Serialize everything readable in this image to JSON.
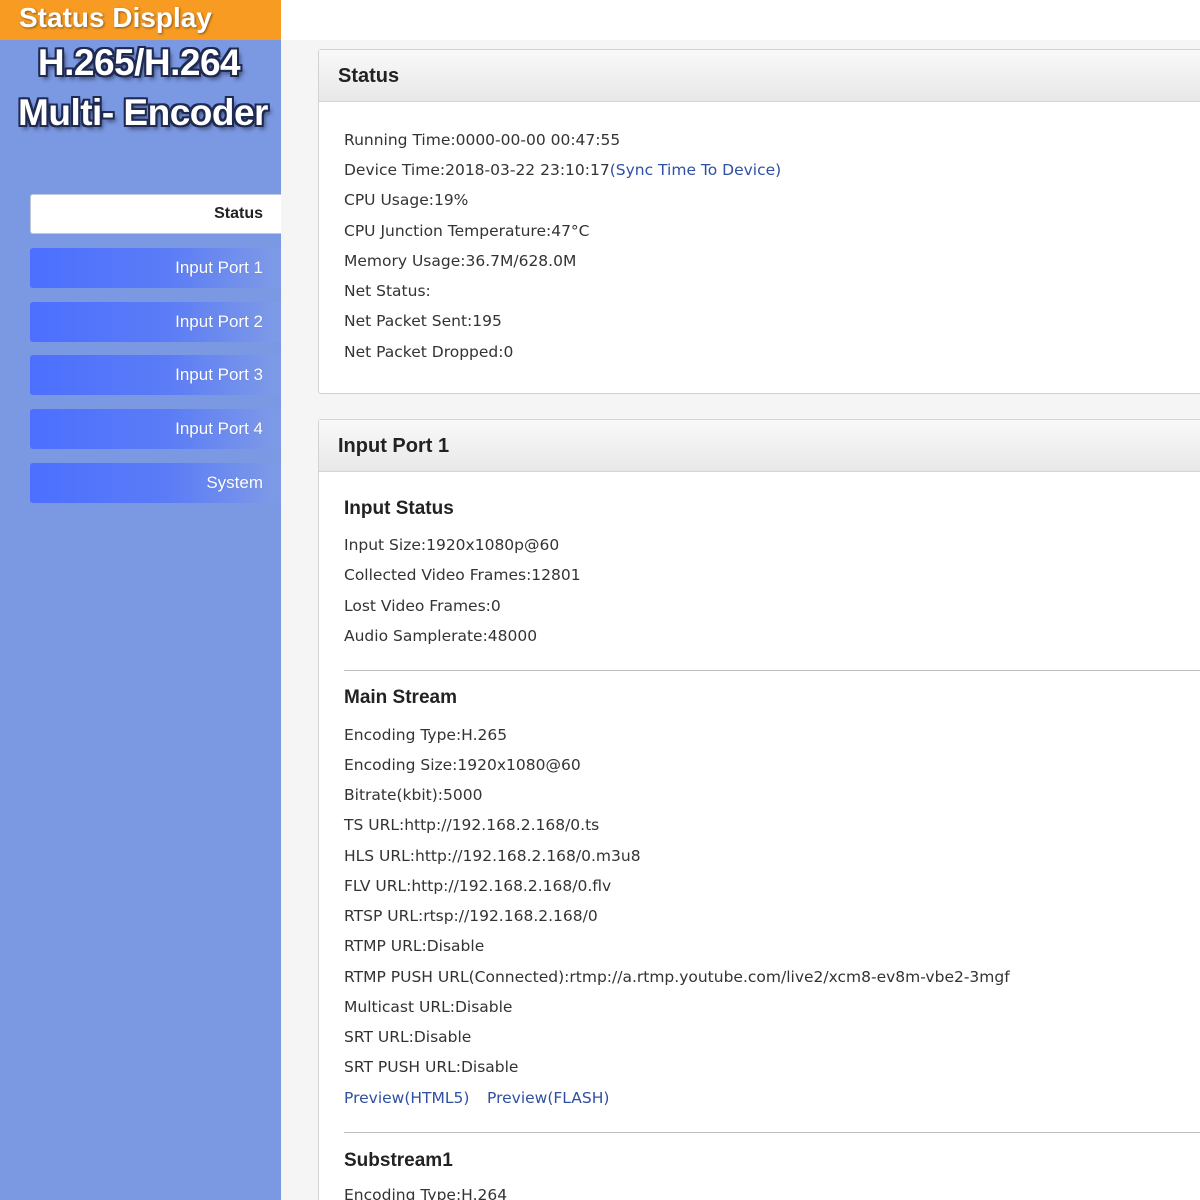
{
  "banner": {
    "title": "Status Display"
  },
  "logo": {
    "line1": "H.265/H.264",
    "line2": "Multi- Encoder"
  },
  "sidebar": {
    "items": [
      {
        "label": "Status",
        "active": true
      },
      {
        "label": "Input Port 1"
      },
      {
        "label": "Input Port 2"
      },
      {
        "label": "Input Port 3"
      },
      {
        "label": "Input Port 4"
      },
      {
        "label": "System"
      }
    ]
  },
  "status_panel": {
    "title": "Status",
    "running_time": "Running Time:0000-00-00 00:47:55",
    "device_time": "Device Time:2018-03-22 23:10:17",
    "sync_link": "(Sync Time To Device)",
    "cpu_usage": "CPU Usage:19%",
    "cpu_temp": "CPU Junction Temperature:47°C",
    "memory": "Memory Usage:36.7M/628.0M",
    "net_status": "Net Status:",
    "packets_sent": "Net Packet Sent:195",
    "packets_dropped": "Net Packet Dropped:0"
  },
  "port1_panel": {
    "title": "Input Port 1",
    "input_status": {
      "heading": "Input Status",
      "input_size": "Input Size:1920x1080p@60",
      "collected_frames": "Collected Video Frames:12801",
      "lost_frames": "Lost Video Frames:0",
      "audio_samplerate": "Audio Samplerate:48000"
    },
    "main_stream": {
      "heading": "Main Stream",
      "encoding_type": "Encoding Type:H.265",
      "encoding_size": "Encoding Size:1920x1080@60",
      "bitrate": "Bitrate(kbit):5000",
      "ts_url": "TS URL:http://192.168.2.168/0.ts",
      "hls_url": "HLS URL:http://192.168.2.168/0.m3u8",
      "flv_url": "FLV URL:http://192.168.2.168/0.flv",
      "rtsp_url": "RTSP URL:rtsp://192.168.2.168/0",
      "rtmp_url": "RTMP URL:Disable",
      "rtmp_push_url": "RTMP PUSH URL(Connected):rtmp://a.rtmp.youtube.com/live2/xcm8-ev8m-vbe2-3mgf",
      "multicast_url": "Multicast URL:Disable",
      "srt_url": "SRT URL:Disable",
      "srt_push_url": "SRT PUSH URL:Disable",
      "preview_html5": "Preview(HTML5)",
      "preview_flash": "Preview(FLASH)"
    },
    "substream1": {
      "heading": "Substream1",
      "encoding_type": "Encoding Type:H.264"
    }
  }
}
